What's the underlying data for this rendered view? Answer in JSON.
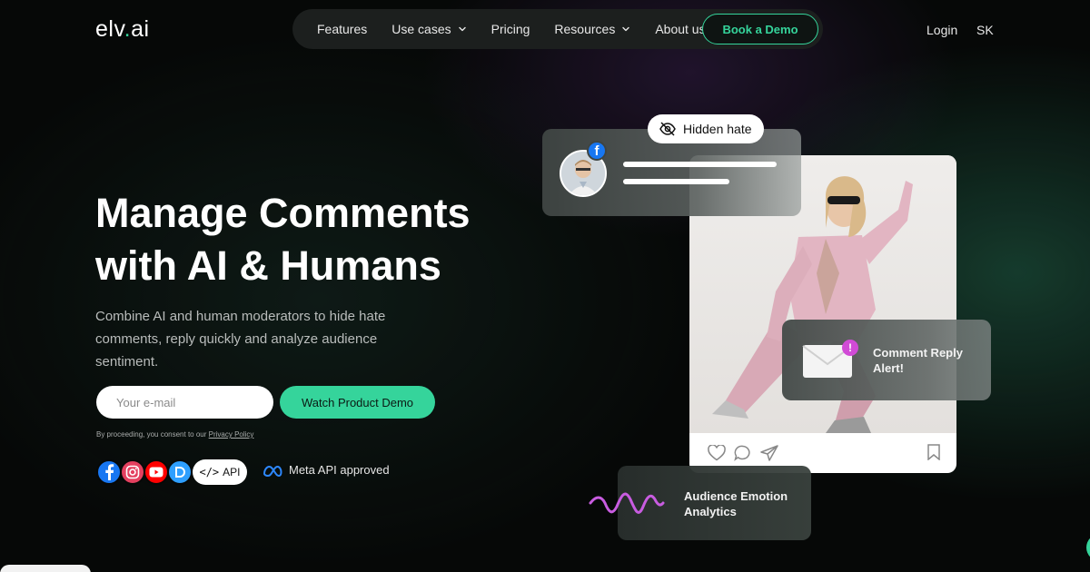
{
  "header": {
    "logo": {
      "pre": "elv",
      "dot": ".",
      "post": "ai"
    },
    "nav": [
      {
        "label": "Features",
        "dropdown": false
      },
      {
        "label": "Use cases",
        "dropdown": true
      },
      {
        "label": "Pricing",
        "dropdown": false
      },
      {
        "label": "Resources",
        "dropdown": true
      },
      {
        "label": "About us",
        "dropdown": false
      }
    ],
    "cta_label": "Book a Demo",
    "login_label": "Login",
    "language": "SK"
  },
  "hero": {
    "title_line1": "Manage Comments",
    "title_line2": "with AI & Humans",
    "subtitle": "Combine AI and human moderators to hide hate comments, reply quickly and analyze audience sentiment.",
    "email_placeholder": "Your e-mail",
    "watch_label": "Watch Product Demo",
    "consent_text": "By proceeding, you consent to our ",
    "consent_link": "Privacy Policy",
    "api_label": "API",
    "api_code": "</>",
    "meta_label": "Meta API approved",
    "platform_icons": [
      "facebook-icon",
      "instagram-icon",
      "youtube-icon",
      "disqus-icon"
    ]
  },
  "visual": {
    "hidden_label": "Hidden hate",
    "alert_label": "Comment Reply Alert!",
    "alert_mark": "!",
    "emotion_label": "Audience Emotion Analytics",
    "fb_mini": "f"
  },
  "colors": {
    "accent": "#35d49b",
    "background": "#060807",
    "facebook": "#1877f2",
    "instagram": "#e4405f",
    "youtube": "#ff0000",
    "disqus": "#2e9fff",
    "alert": "#d14bd6"
  }
}
